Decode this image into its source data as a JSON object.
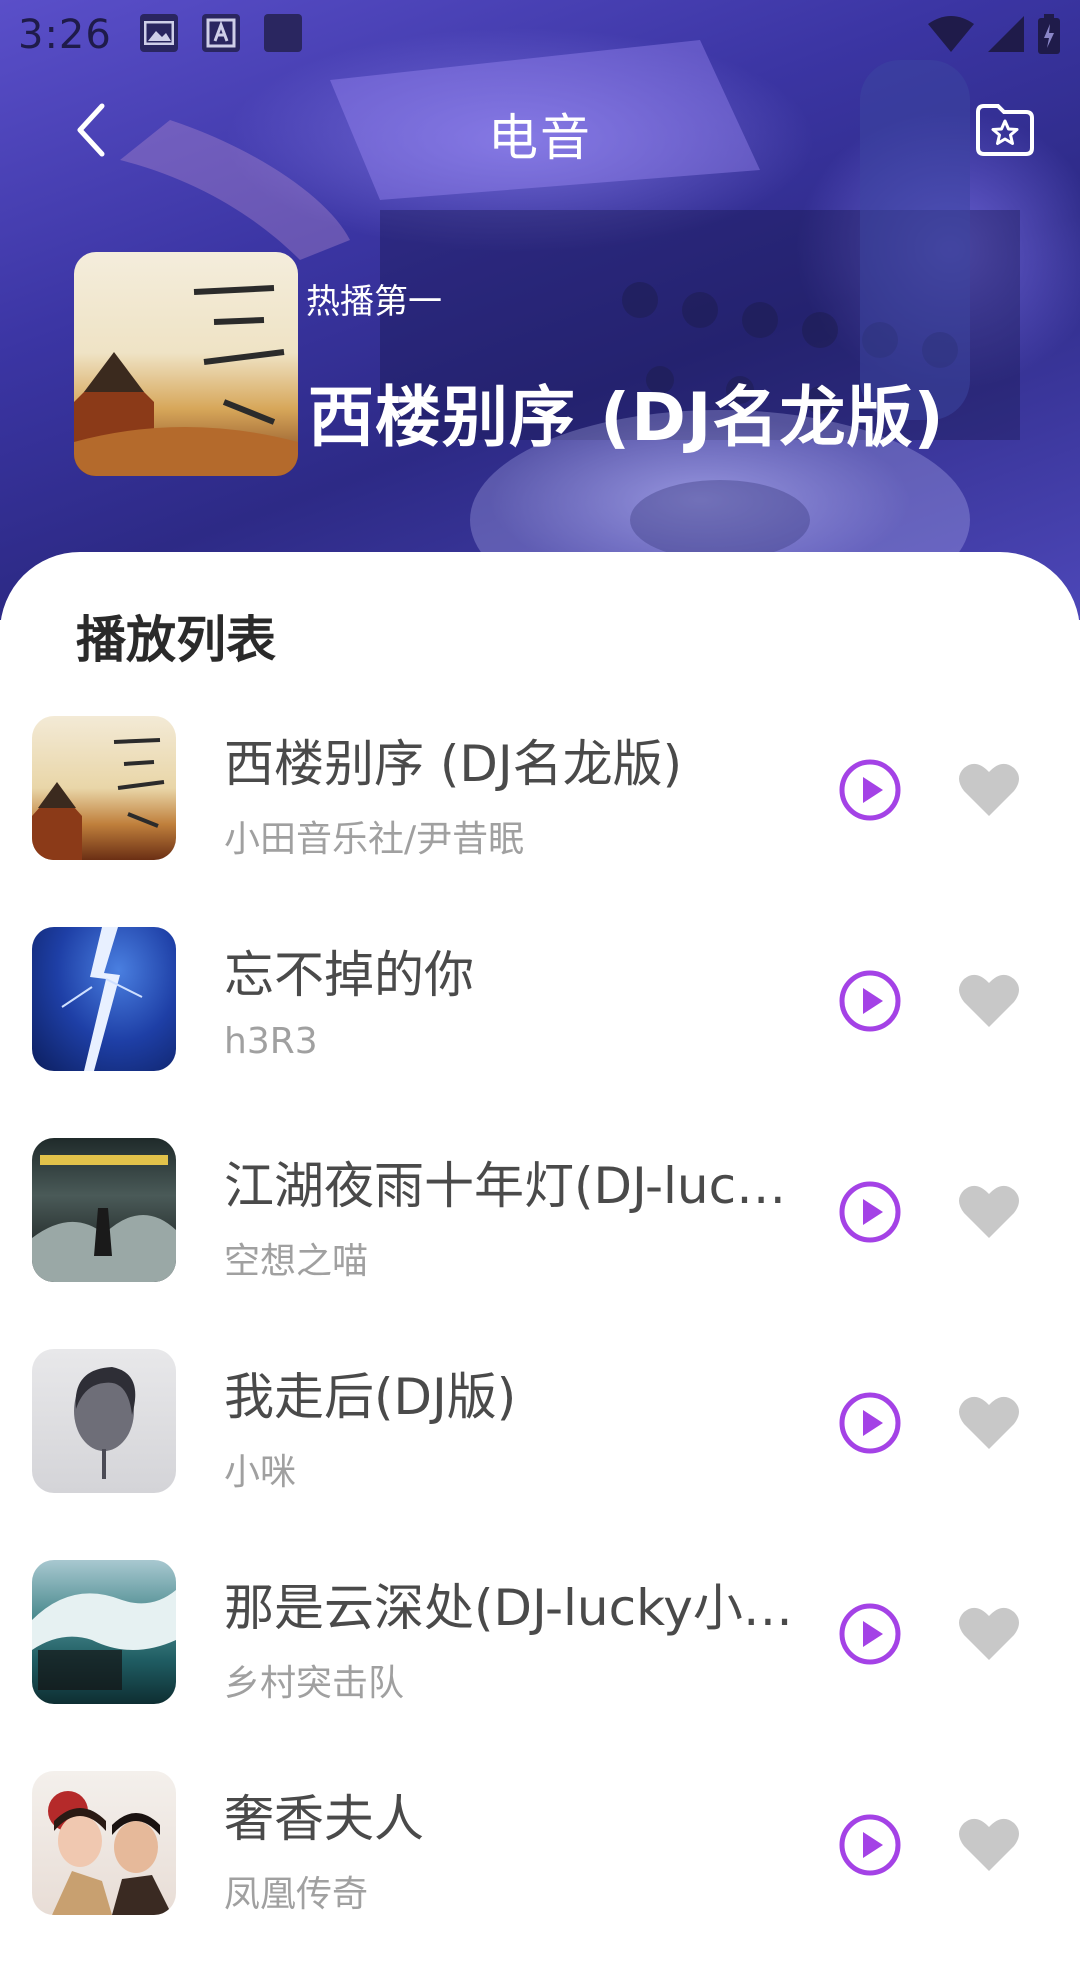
{
  "status": {
    "time": "3:26"
  },
  "header": {
    "title": "电音"
  },
  "featured": {
    "tag": "热播第一",
    "title": "西楼别序 (DJ名龙版)"
  },
  "playlist": {
    "heading": "播放列表",
    "tracks": [
      {
        "title": "西楼别序 (DJ名龙版)",
        "artist": "小田音乐社/尹昔眠",
        "cover": "ancient-pavilion-art"
      },
      {
        "title": "忘不掉的你",
        "artist": "h3R3",
        "cover": "lightning-storm"
      },
      {
        "title": "江湖夜雨十年灯(DJ-lucky…",
        "artist": "空想之喵",
        "cover": "misty-wanderer"
      },
      {
        "title": "我走后(DJ版)",
        "artist": "小咪",
        "cover": "ink-portrait"
      },
      {
        "title": "那是云深处(DJ-lucky小…",
        "artist": "乡村突击队",
        "cover": "ocean-wave"
      },
      {
        "title": "奢香夫人",
        "artist": "凤凰传奇",
        "cover": "duo-portrait"
      }
    ]
  },
  "colors": {
    "accent": "#a442e6",
    "like": "#c8c8c8"
  }
}
